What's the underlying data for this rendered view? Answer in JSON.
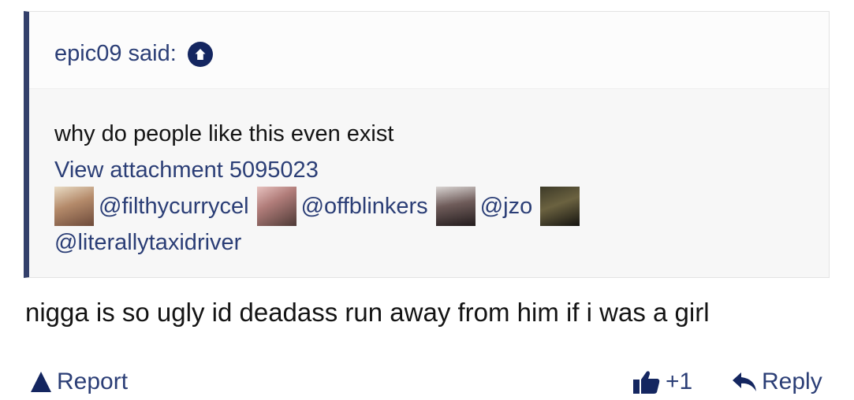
{
  "quote": {
    "author": "epic09 said:",
    "text": "why do people like this even exist",
    "attachment_link": "View attachment 5095023",
    "mentions": [
      {
        "handle": "@filthycurrycel"
      },
      {
        "handle": "@offblinkers"
      },
      {
        "handle": "@jzo"
      },
      {
        "handle": "@literallytaxidriver"
      }
    ]
  },
  "post": {
    "text": "nigga is so ugly id deadass run away from him if i was a girl"
  },
  "footer": {
    "report_label": "Report",
    "like_count": "+1",
    "reply_label": "Reply"
  },
  "colors": {
    "link": "#2b3e76",
    "quote_border": "#33406b",
    "icon_dark": "#142660"
  }
}
